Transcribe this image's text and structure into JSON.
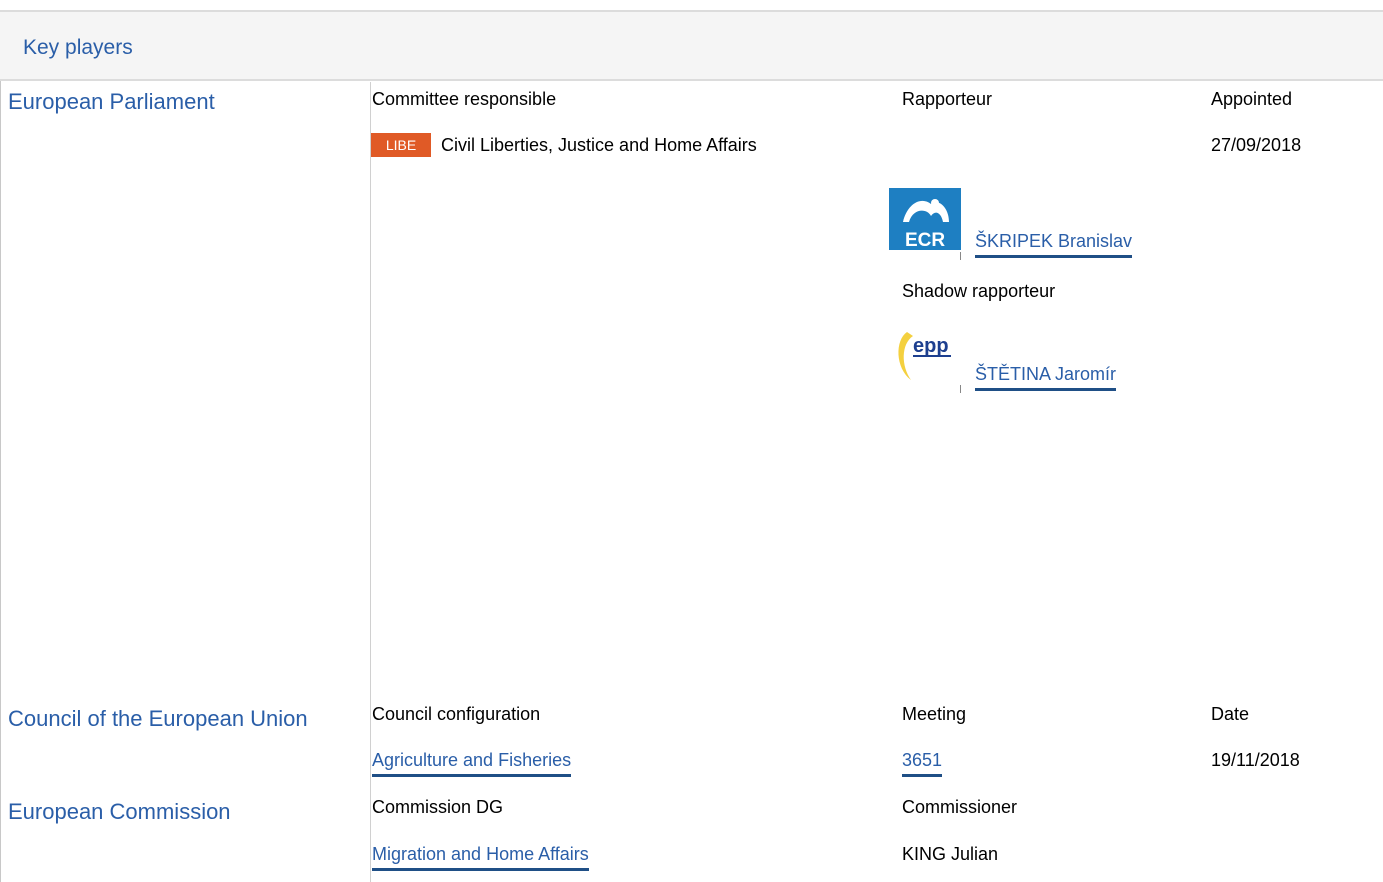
{
  "section_title": "Key players",
  "parliament": {
    "org": "European Parliament",
    "col1_header": "Committee responsible",
    "col2_header": "Rapporteur",
    "col3_header": "Appointed",
    "committee_code": "LIBE",
    "committee_name": "Civil Liberties, Justice and Home Affairs",
    "appointed_date": "27/09/2018",
    "rapporteur": {
      "group_logo": "ECR",
      "name": "ŠKRIPEK Branislav"
    },
    "shadow_label": "Shadow rapporteur",
    "shadow": {
      "group_logo": "epp",
      "name": "ŠTĚTINA Jaromír"
    }
  },
  "council": {
    "org": "Council of the European Union",
    "col1_header": "Council configuration",
    "col2_header": "Meeting",
    "col3_header": "Date",
    "configuration": "Agriculture and Fisheries",
    "meeting": "3651",
    "date": "19/11/2018"
  },
  "commission": {
    "org": "European Commission",
    "col1_header": "Commission DG",
    "col2_header": "Commissioner",
    "dg": "Migration and Home Affairs",
    "commissioner": "KING Julian"
  },
  "colors": {
    "link": "#2a5ea8",
    "link_underline": "#1f4f86",
    "committee_badge": "#e05a26",
    "ecr_logo": "#1e7fc2",
    "epp_yellow": "#f4d03f",
    "epp_blue": "#1d3f8f"
  }
}
